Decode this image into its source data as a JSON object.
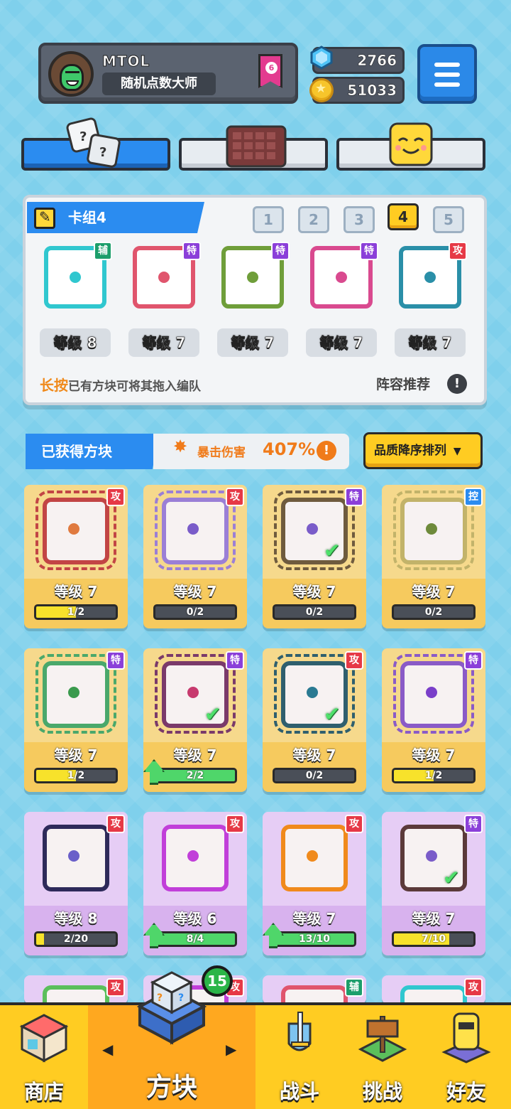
{
  "profile": {
    "name": "MTOL",
    "title": "随机点数大师",
    "rank": "6"
  },
  "currency": {
    "gems": "2766",
    "coins": "51033"
  },
  "top_tabs": [
    {
      "icon": "dice-icon",
      "active": true
    },
    {
      "icon": "board-icon",
      "active": false
    },
    {
      "icon": "emoji-face-icon",
      "active": false
    }
  ],
  "deck": {
    "title": "卡组4",
    "numbers": [
      "1",
      "2",
      "3",
      "4",
      "5"
    ],
    "active_number": "4",
    "cards": [
      {
        "tag": "辅",
        "tag_type": "sup",
        "level": "等级 8",
        "color": "#30c7cf"
      },
      {
        "tag": "特",
        "tag_type": "spe",
        "level": "等级 7",
        "color": "#e0556d"
      },
      {
        "tag": "特",
        "tag_type": "spe",
        "level": "等级 7",
        "color": "#6f9e3a"
      },
      {
        "tag": "特",
        "tag_type": "spe",
        "level": "等级 7",
        "color": "#d94a8f"
      },
      {
        "tag": "攻",
        "tag_type": "atk",
        "level": "等级 7",
        "color": "#2a8fa8"
      }
    ],
    "hint_highlight": "长按",
    "hint_text": "已有方块可将其拖入编队",
    "recommend": "阵容推荐",
    "recommend_icon": "!"
  },
  "owned": {
    "title": "已获得方块",
    "crit_label": "暴击伤害",
    "crit_value": "407%",
    "crit_icon": "!",
    "sort_label": "品质降序排列",
    "sort_icon": "▼",
    "cards": [
      {
        "tag": "攻",
        "tag_type": "atk",
        "level": "等级 7",
        "progress": "1/2",
        "fill": 0.5,
        "up": false,
        "checked": false,
        "rarity": "gold",
        "border": "#c24545",
        "pip": "#e07a3f"
      },
      {
        "tag": "攻",
        "tag_type": "atk",
        "level": "等级 7",
        "progress": "0/2",
        "fill": 0,
        "up": false,
        "checked": false,
        "rarity": "gold",
        "border": "#9b7fd6",
        "pip": "#7a5cc9"
      },
      {
        "tag": "特",
        "tag_type": "spe",
        "level": "等级 7",
        "progress": "0/2",
        "fill": 0,
        "up": false,
        "checked": true,
        "rarity": "gold",
        "border": "#6f5b3e",
        "pip": "#7a5cc9"
      },
      {
        "tag": "控",
        "tag_type": "ctl",
        "level": "等级 7",
        "progress": "0/2",
        "fill": 0,
        "up": false,
        "checked": false,
        "rarity": "gold",
        "border": "#c2b36a",
        "pip": "#6e8a3b"
      },
      {
        "tag": "特",
        "tag_type": "spe",
        "level": "等级 7",
        "progress": "1/2",
        "fill": 0.5,
        "up": false,
        "checked": false,
        "rarity": "gold",
        "border": "#4aa86b",
        "pip": "#3a9a4d"
      },
      {
        "tag": "特",
        "tag_type": "spe",
        "level": "等级 7",
        "progress": "2/2",
        "fill": 1,
        "up": true,
        "checked": true,
        "rarity": "gold",
        "border": "#7a3a6a",
        "pip": "#c73a6e"
      },
      {
        "tag": "攻",
        "tag_type": "atk",
        "level": "等级 7",
        "progress": "0/2",
        "fill": 0,
        "up": false,
        "checked": true,
        "rarity": "gold",
        "border": "#2f5f6e",
        "pip": "#2a7a92"
      },
      {
        "tag": "特",
        "tag_type": "spe",
        "level": "等级 7",
        "progress": "1/2",
        "fill": 0.5,
        "up": false,
        "checked": false,
        "rarity": "gold",
        "border": "#8a5bc7",
        "pip": "#7a3fc9"
      },
      {
        "tag": "攻",
        "tag_type": "atk",
        "level": "等级 8",
        "progress": "2/20",
        "fill": 0.1,
        "up": false,
        "checked": false,
        "rarity": "purple",
        "border": "#2e2a5a",
        "pip": "#6a5fc9"
      },
      {
        "tag": "攻",
        "tag_type": "atk",
        "level": "等级 6",
        "progress": "8/4",
        "fill": 1,
        "up": true,
        "checked": false,
        "rarity": "purple",
        "border": "#c13fd9",
        "pip": "#c13fd9"
      },
      {
        "tag": "攻",
        "tag_type": "atk",
        "level": "等级 7",
        "progress": "13/10",
        "fill": 1,
        "up": true,
        "checked": false,
        "rarity": "purple",
        "border": "#f08a1c",
        "pip": "#f08a1c"
      },
      {
        "tag": "特",
        "tag_type": "spe",
        "level": "等级 7",
        "progress": "7/10",
        "fill": 0.7,
        "up": false,
        "checked": true,
        "rarity": "purple",
        "border": "#5b3a3a",
        "pip": "#7a5cc9"
      }
    ],
    "partial_row_tags": [
      {
        "tag": "攻",
        "tag_type": "atk"
      },
      {
        "tag": "攻",
        "tag_type": "atk"
      },
      {
        "tag": "辅",
        "tag_type": "sup"
      },
      {
        "tag": "攻",
        "tag_type": "atk"
      }
    ]
  },
  "nav": {
    "shop": "商店",
    "blocks": "方块",
    "battle": "战斗",
    "challenge": "挑战",
    "friends": "好友",
    "blocks_badge": "15",
    "prev": "◀",
    "next": "▶"
  },
  "colors": {
    "accent_blue": "#2b8cf0",
    "accent_yellow": "#ffcc22",
    "crit_orange": "#f07b1a"
  }
}
